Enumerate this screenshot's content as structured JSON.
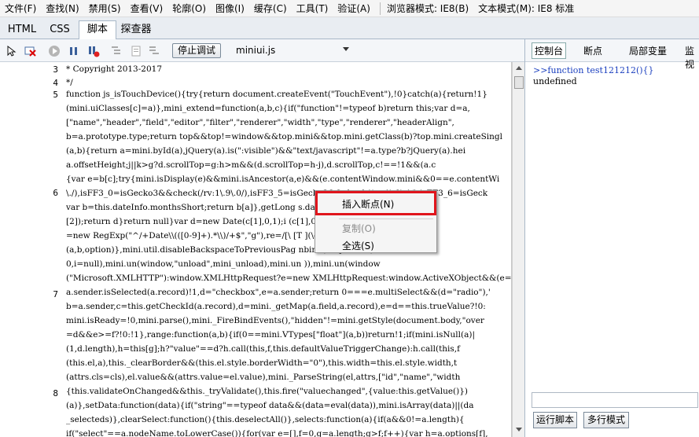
{
  "menu": [
    "文件(F)",
    "查找(N)",
    "禁用(S)",
    "查看(V)",
    "轮廓(O)",
    "图像(I)",
    "缓存(C)",
    "工具(T)",
    "验证(A)"
  ],
  "browser_mode": "浏览器模式: IE8(B)",
  "doc_mode": "文本模式(M): IE8 标准",
  "tabs": [
    "HTML",
    "CSS",
    "脚本",
    "探查器"
  ],
  "toolbar": {
    "stop_debug": "停止调试",
    "file": "miniui.js"
  },
  "right_tabs": [
    "控制台",
    "断点",
    "局部变量",
    "监视"
  ],
  "console": {
    "input_line": ">>function test121212(){}",
    "output_line": "undefined"
  },
  "right_buttons": {
    "run_script": "运行脚本",
    "multiline": "多行模式"
  },
  "context_menu": {
    "insert_breakpoint": "插入断点(N)",
    "copy": "复制(O)",
    "select_all": "全选(S)"
  },
  "code": {
    "gutter": [
      "3",
      "4",
      "5",
      "6",
      "7",
      "8"
    ],
    "lines": [
      " * Copyright 2013-2017",
      " */",
      "function js_isTouchDevice(){try{return document.createEvent(\"TouchEvent\"),!0}catch(a){return!1}",
      "(mini.uiClasses[c]=a)},mini_extend=function(a,b,c){if(\"function\"!=typeof b)return this;var d=a,",
      "[\"name\",\"header\",\"field\",\"editor\",\"filter\",\"renderer\",\"width\",\"type\",\"renderer\",\"headerAlign\",",
      "b=a.prototype.type;return top&&top!=window&&top.mini&&top.mini.getClass(b)?top.mini.createSingl",
      "(a,b){return a=mini.byId(a),jQuery(a).is(\":visible\")&&\"text/javascript\"!=a.type?b?jQuery(a).hei",
      "a.offsetHeight;j||k>g?d.scrollTop=g:h>m&&(d.scrollTop=h-j),d.scrollTop,c!==!1&&(a.c",
      "{var e=b[c];try{mini.isDisplay(e)&&mini.isAncestor(a,e)&&(e.contentWindow.mini&&0==e.contentWi",
      "\\./),isFF3_0=isGecko3&&check(/rv:1\\.9\\.0/),isFF3_5=isGecko3&&check(/rv:1\\.9\\.1/),isFF3_6=isGeck",
      "var b=this.dateInfo.monthsShort;return b[a]},getLong                    s.dateInfo.month",
      "[2]);return d}return null}var d=new Date(c[1],0,1);i                    (c[1],0,1,9,0);c",
      "=new RegExp(\"^/+Date\\\\(([0-9]+).*\\\\)/+$\",\"g\"),re=/[\\                    [T ](\\d{2}):(\\d{",
      "(a,b,option)},mini.util.disableBackspaceToPreviousPag                    nbind(\"keydown\")",
      "0,i=null),mini.un(window,\"unload\",mini_unload),mini.un                    )),mini.un(window",
      "(\"Microsoft.XMLHTTP\"):window.XMLHttpRequest?e=new XMLHttpRequest:window.ActiveXObject&&(e=new A",
      "a.sender.isSelected(a.record)!1,d=\"checkbox\",e=a.sender;return 0===e.multiSelect&&(d=\"radio\"),'",
      "b=a.sender,c=this.getCheckId(a.record),d=mini._getMap(a.field,a.record),e=d==this.trueValue?!0:",
      "mini.isReady=!0,mini.parse(),mini._FireBindEvents(),\"hidden\"!=mini.getStyle(document.body,\"over",
      "=d&&e>=f?!0:!1},range:function(a,b){if(0==mini.VTypes[\"float\"](a,b))return!1;if(mini.isNull(a)|",
      "(1,d.length),h=this[g];h?\"value\"==d?h.call(this,f,this.defaultValueTriggerChange):h.call(this,f",
      "(this.el,a),this._clearBorder&&(this.el.style.borderWidth=\"0\"),this.width=this.el.style.width,t",
      "(attrs.cls=cls),el.value&&(attrs.value=el.value),mini._ParseString(el,attrs,[\"id\",\"name\",\"width",
      "{this.validateOnChanged&&this._tryValidate(),this.fire(\"valuechanged\",{value:this.getValue()})",
      "(a)},setData:function(data){if(\"string\"==typeof data&&(data=eval(data)),mini.isArray(data)||(da",
      "_selecteds)},clearSelect:function(){this.deselectAll()},selects:function(a){if(a&&0!=a.length){",
      "if(\"select\"==a.nodeName.toLowerCase()){for(var e=[],f=0,g=a.length;g>f;f++){var h=a.options[f],",
      "[]),b.push(e)}a.push(b)}else{for(var f=this.repeatItems>this.data.length?this.data.length:this."
    ]
  }
}
